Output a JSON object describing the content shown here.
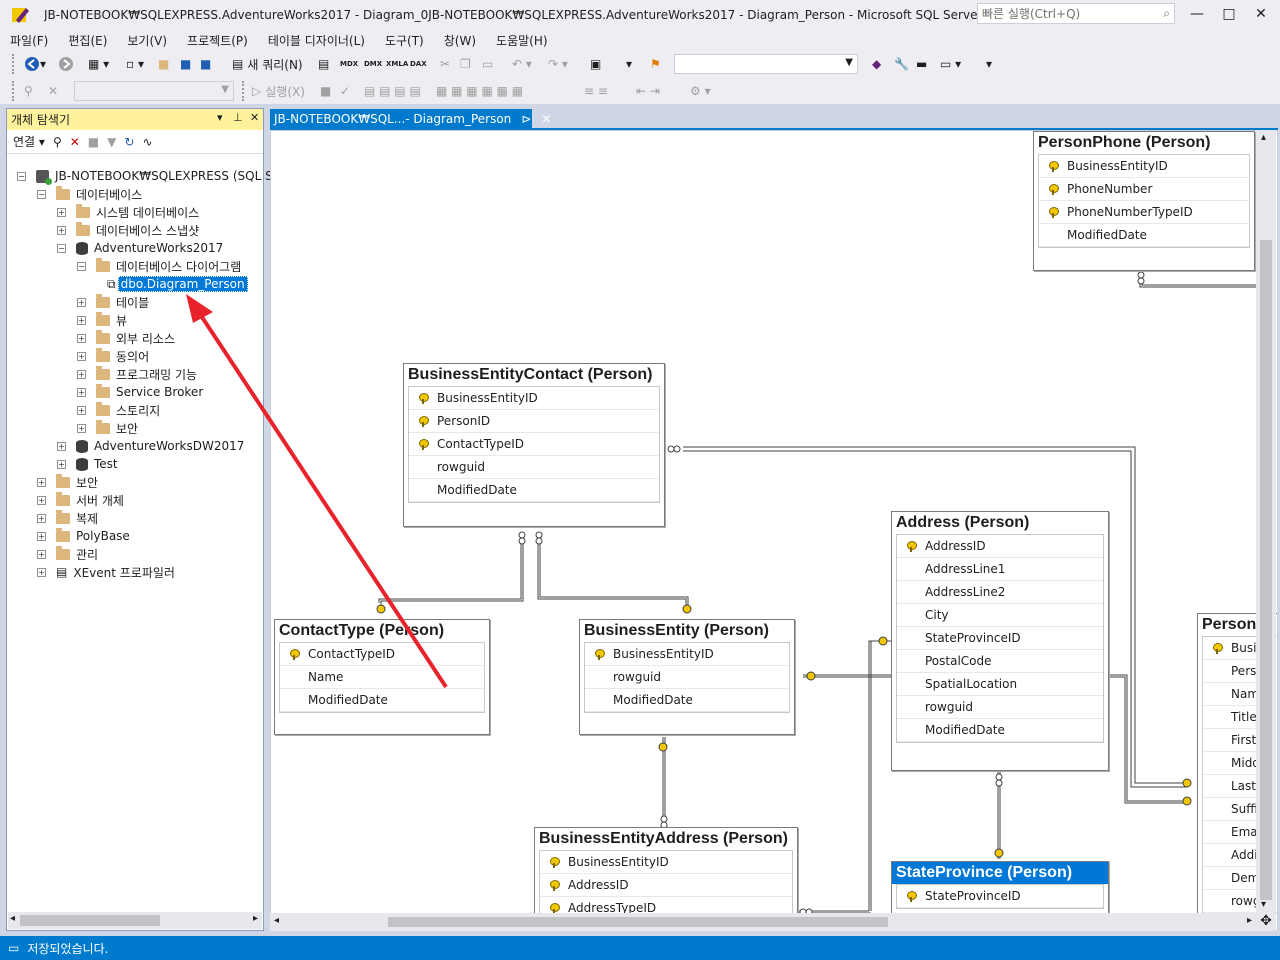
{
  "window": {
    "title": "JB-NOTEBOOK₩SQLEXPRESS.AdventureWorks2017 - Diagram_0JB-NOTEBOOK₩SQLEXPRESS.AdventureWorks2017 - Diagram_Person - Microsoft SQL Server Managemen...",
    "quick_launch_placeholder": "빠른 실행(Ctrl+Q)",
    "minimize": "—",
    "restore": "□",
    "close": "✕"
  },
  "menu": [
    "파일(F)",
    "편집(E)",
    "보기(V)",
    "프로젝트(P)",
    "테이블 디자이너(L)",
    "도구(T)",
    "창(W)",
    "도움말(H)"
  ],
  "toolbar": {
    "new_query": "새 쿼리(N)",
    "execute": "실행(X)",
    "mdx": "MDX",
    "dmx": "DMX",
    "xmla": "XMLA",
    "dax": "DAX"
  },
  "object_explorer": {
    "title": "개체 탐색기",
    "connect": "연결",
    "tree": [
      {
        "label": "JB-NOTEBOOK₩SQLEXPRESS (SQL Serv",
        "icon": "server",
        "exp": "-"
      },
      {
        "label": "데이터베이스",
        "icon": "folder",
        "exp": "-"
      },
      {
        "label": "시스템 데이터베이스",
        "icon": "folder",
        "exp": "+"
      },
      {
        "label": "데이터베이스 스냅샷",
        "icon": "folder",
        "exp": "+"
      },
      {
        "label": "AdventureWorks2017",
        "icon": "db",
        "exp": "-"
      },
      {
        "label": "데이터베이스 다이어그램",
        "icon": "folder",
        "exp": "-"
      },
      {
        "label": "dbo.Diagram_Person",
        "icon": "diagram",
        "exp": ""
      },
      {
        "label": "테이블",
        "icon": "folder",
        "exp": "+"
      },
      {
        "label": "뷰",
        "icon": "folder",
        "exp": "+"
      },
      {
        "label": "외부 리소스",
        "icon": "folder",
        "exp": "+"
      },
      {
        "label": "동의어",
        "icon": "folder",
        "exp": "+"
      },
      {
        "label": "프로그래밍 기능",
        "icon": "folder",
        "exp": "+"
      },
      {
        "label": "Service Broker",
        "icon": "folder",
        "exp": "+"
      },
      {
        "label": "스토리지",
        "icon": "folder",
        "exp": "+"
      },
      {
        "label": "보안",
        "icon": "folder",
        "exp": "+"
      },
      {
        "label": "AdventureWorksDW2017",
        "icon": "db",
        "exp": "+"
      },
      {
        "label": "Test",
        "icon": "db",
        "exp": "+"
      },
      {
        "label": "보안",
        "icon": "folder",
        "exp": "+"
      },
      {
        "label": "서버 개체",
        "icon": "folder",
        "exp": "+"
      },
      {
        "label": "복제",
        "icon": "folder",
        "exp": "+"
      },
      {
        "label": "PolyBase",
        "icon": "folder",
        "exp": "+"
      },
      {
        "label": "관리",
        "icon": "folder",
        "exp": "+"
      },
      {
        "label": "XEvent 프로파일러",
        "icon": "xevent",
        "exp": "+"
      }
    ]
  },
  "document_tab": {
    "label": "JB-NOTEBOOK₩SQL...- Diagram_Person",
    "pin": "⊳",
    "close": "✕"
  },
  "diagram": {
    "tables": [
      {
        "id": "personphone",
        "title": "PersonPhone (Person)",
        "columns": [
          {
            "name": "BusinessEntityID",
            "key": true
          },
          {
            "name": "PhoneNumber",
            "key": true
          },
          {
            "name": "PhoneNumberTypeID",
            "key": true
          },
          {
            "name": "ModifiedDate",
            "key": false
          }
        ]
      },
      {
        "id": "bec",
        "title": "BusinessEntityContact (Person)",
        "columns": [
          {
            "name": "BusinessEntityID",
            "key": true
          },
          {
            "name": "PersonID",
            "key": true
          },
          {
            "name": "ContactTypeID",
            "key": true
          },
          {
            "name": "rowguid",
            "key": false
          },
          {
            "name": "ModifiedDate",
            "key": false
          }
        ]
      },
      {
        "id": "address",
        "title": "Address (Person)",
        "columns": [
          {
            "name": "AddressID",
            "key": true
          },
          {
            "name": "AddressLine1",
            "key": false
          },
          {
            "name": "AddressLine2",
            "key": false
          },
          {
            "name": "City",
            "key": false
          },
          {
            "name": "StateProvinceID",
            "key": false
          },
          {
            "name": "PostalCode",
            "key": false
          },
          {
            "name": "SpatialLocation",
            "key": false
          },
          {
            "name": "rowguid",
            "key": false
          },
          {
            "name": "ModifiedDate",
            "key": false
          }
        ]
      },
      {
        "id": "contacttype",
        "title": "ContactType (Person)",
        "columns": [
          {
            "name": "ContactTypeID",
            "key": true
          },
          {
            "name": "Name",
            "key": false
          },
          {
            "name": "ModifiedDate",
            "key": false
          }
        ]
      },
      {
        "id": "be",
        "title": "BusinessEntity (Person)",
        "columns": [
          {
            "name": "BusinessEntityID",
            "key": true
          },
          {
            "name": "rowguid",
            "key": false
          },
          {
            "name": "ModifiedDate",
            "key": false
          }
        ]
      },
      {
        "id": "person",
        "title": "Person",
        "columns": [
          {
            "name": "Busin",
            "key": true
          },
          {
            "name": "Perso",
            "key": false
          },
          {
            "name": "Name",
            "key": false
          },
          {
            "name": "Title",
            "key": false
          },
          {
            "name": "FirstN",
            "key": false
          },
          {
            "name": "Midd",
            "key": false
          },
          {
            "name": "LastN",
            "key": false
          },
          {
            "name": "Suffix",
            "key": false
          },
          {
            "name": "Email",
            "key": false
          },
          {
            "name": "Addit",
            "key": false
          },
          {
            "name": "Demo",
            "key": false
          },
          {
            "name": "rowg",
            "key": false
          }
        ]
      },
      {
        "id": "bea",
        "title": "BusinessEntityAddress (Person)",
        "columns": [
          {
            "name": "BusinessEntityID",
            "key": true
          },
          {
            "name": "AddressID",
            "key": true
          },
          {
            "name": "AddressTypeID",
            "key": true
          }
        ]
      },
      {
        "id": "stateprovince",
        "title": "StateProvince (Person)",
        "columns": [
          {
            "name": "StateProvinceID",
            "key": true
          }
        ]
      }
    ]
  },
  "status": {
    "text": "저장되었습니다."
  },
  "colors": {
    "accent": "#007acc",
    "selection": "#0078d7",
    "annotation_arrow": "#e8232b",
    "oe_header": "#fff29d"
  }
}
